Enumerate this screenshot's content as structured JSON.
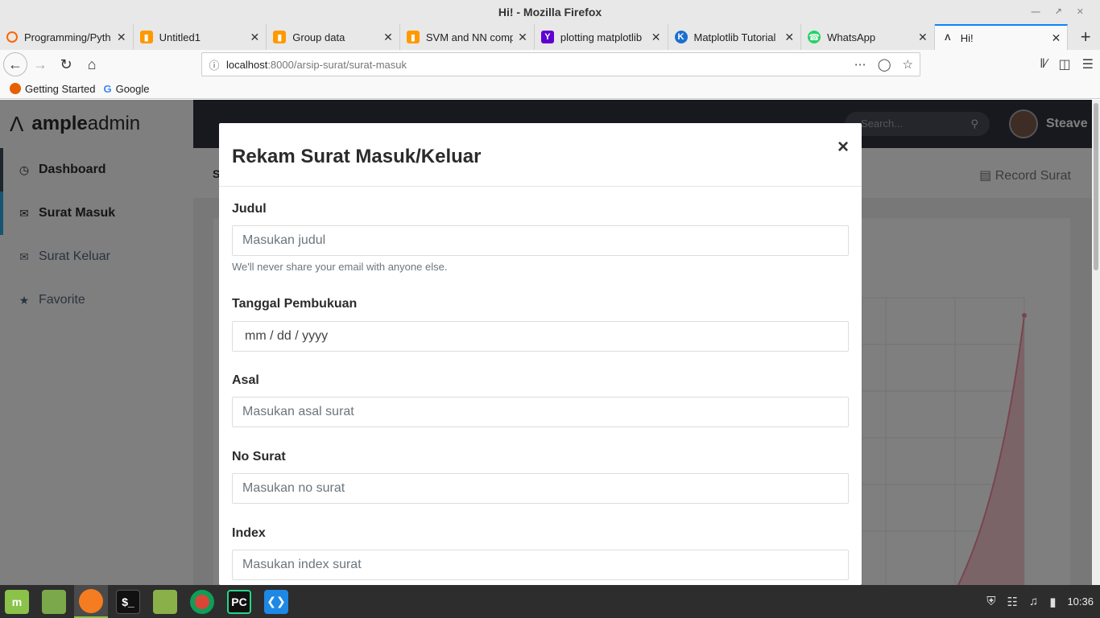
{
  "window": {
    "title": "Hi! - Mozilla Firefox"
  },
  "tabs": [
    {
      "label": "Programming/Pyth",
      "icon": "loading-icon",
      "color": "#f60"
    },
    {
      "label": "Untitled1",
      "icon": "book-icon",
      "color": "#f90"
    },
    {
      "label": "Group data",
      "icon": "book-icon",
      "color": "#f90"
    },
    {
      "label": "SVM and NN comp",
      "icon": "book-icon",
      "color": "#f90"
    },
    {
      "label": "plotting matplotlib",
      "icon": "yahoo-icon",
      "color": "#5f01d1"
    },
    {
      "label": "Matplotlib Tutorial",
      "icon": "site-icon",
      "color": "#1c6fd1"
    },
    {
      "label": "WhatsApp",
      "icon": "whatsapp-icon",
      "color": "#25d366"
    },
    {
      "label": "Hi!",
      "icon": "ample-icon",
      "color": "#333"
    }
  ],
  "url": {
    "host": "localhost",
    "path": ":8000/arsip-surat/surat-masuk"
  },
  "bookmarks": [
    {
      "label": "Getting Started"
    },
    {
      "label": "Google"
    }
  ],
  "brand": {
    "ample": "ample",
    "admin": "admin"
  },
  "sidebar": {
    "items": [
      {
        "label": "Dashboard",
        "icon": "clock-icon"
      },
      {
        "label": "Surat Masuk",
        "icon": "envelope-icon"
      },
      {
        "label": "Surat Keluar",
        "icon": "envelope-open-icon"
      },
      {
        "label": "Favorite",
        "icon": "star-icon"
      }
    ]
  },
  "header": {
    "search_placeholder": "Search...",
    "username": "Steave"
  },
  "crumb": {
    "left": "S",
    "right_action": "Record Surat"
  },
  "modal": {
    "title": "Rekam Surat Masuk/Keluar",
    "close": "×",
    "fields": [
      {
        "label": "Judul",
        "placeholder": "Masukan judul",
        "help": "We'll never share your email with anyone else."
      },
      {
        "label": "Tanggal Pembukuan",
        "value": "mm / dd / yyyy"
      },
      {
        "label": "Asal",
        "placeholder": "Masukan asal surat"
      },
      {
        "label": "No Surat",
        "placeholder": "Masukan no surat"
      },
      {
        "label": "Index",
        "placeholder": "Masukan index surat"
      }
    ]
  },
  "taskbar": {
    "clock": "10:36"
  }
}
